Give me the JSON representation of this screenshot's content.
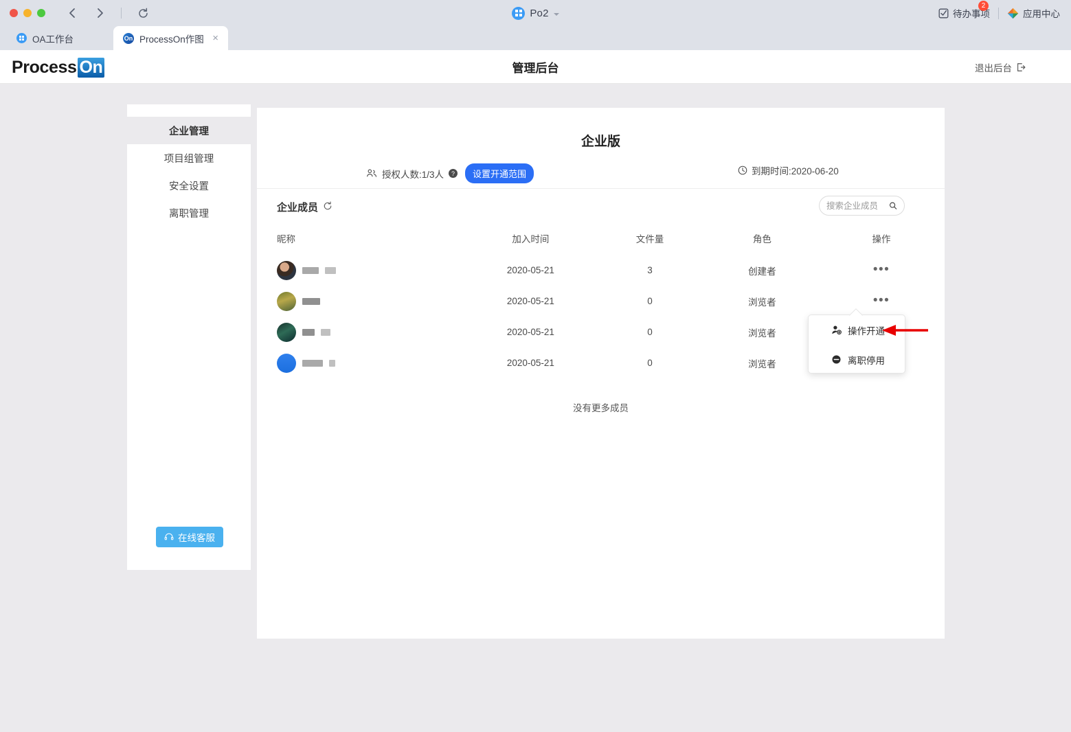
{
  "browser": {
    "traffic_lights": [
      "close",
      "minimize",
      "maximize"
    ],
    "back_icon": "chevron-left-icon",
    "forward_icon": "chevron-right-icon",
    "reload_icon": "reload-icon",
    "workspace": {
      "label": "Po2",
      "icon": "grid-app-icon",
      "caret": "chevron-down-icon"
    },
    "right_items": [
      {
        "label": "待办事项",
        "icon": "checkbox-task-icon",
        "badge": "2"
      },
      {
        "label": "应用中心",
        "icon": "app-center-icon"
      }
    ],
    "tabs": [
      {
        "label": "OA工作台",
        "icon": "grid-app-icon",
        "active": false
      },
      {
        "label": "ProcessOn作图",
        "icon": "processon-on-icon",
        "active": true,
        "close": "×"
      }
    ]
  },
  "app_header": {
    "logo_text": "Process",
    "logo_badge": "On",
    "title": "管理后台",
    "logout_label": "退出后台",
    "logout_icon": "logout-icon"
  },
  "sidebar": {
    "items": [
      {
        "label": "企业管理",
        "active": true
      },
      {
        "label": "项目组管理",
        "active": false
      },
      {
        "label": "安全设置",
        "active": false
      },
      {
        "label": "离职管理",
        "active": false
      }
    ],
    "support_button": {
      "label": "在线客服",
      "icon": "headset-icon",
      "color": "#4ab1ef"
    }
  },
  "plan": {
    "title": "企业版",
    "seats_icon": "people-icon",
    "seats_label": "授权人数:1/3人",
    "help_icon": "question-mark-icon",
    "scope_button": "设置开通范围",
    "scope_button_color": "#2b6ef5",
    "expiry_icon": "clock-icon",
    "expiry_label": "到期时间:2020-06-20"
  },
  "members_section": {
    "title": "企业成员",
    "refresh_icon": "refresh-icon",
    "search": {
      "placeholder": "搜索企业成员",
      "value": "",
      "icon": "search-icon"
    },
    "columns": [
      "昵称",
      "加入时间",
      "文件量",
      "角色",
      "操作"
    ],
    "rows": [
      {
        "name": "",
        "avatar": "photo-portrait",
        "join_date": "2020-05-21",
        "files": "3",
        "role": "创建者",
        "action_icon": "more-dots-icon"
      },
      {
        "name": "",
        "avatar": "photo-landscape",
        "join_date": "2020-05-21",
        "files": "0",
        "role": "浏览者",
        "action_icon": "more-dots-icon"
      },
      {
        "name": "",
        "avatar": "photo-dark-green",
        "join_date": "2020-05-21",
        "files": "0",
        "role": "浏览者",
        "action_icon": "more-dots-icon"
      },
      {
        "name": "",
        "avatar": "solid-blue",
        "join_date": "2020-05-21",
        "files": "0",
        "role": "浏览者",
        "action_icon": "more-dots-icon"
      }
    ],
    "empty_footer": "没有更多成员"
  },
  "dropdown_menu": {
    "items": [
      {
        "label": "操作开通",
        "icon": "person-add-icon"
      },
      {
        "label": "离职停用",
        "icon": "minus-circle-icon"
      }
    ]
  },
  "annotation": {
    "arrow_color": "#e80000",
    "points_to": "操作开通"
  }
}
